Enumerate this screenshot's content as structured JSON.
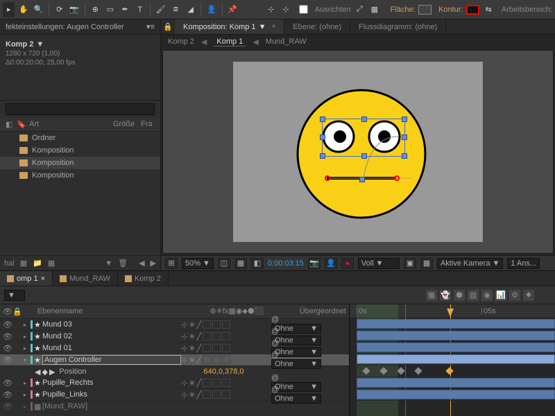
{
  "toolbar": {
    "align_label": "Ausrichten",
    "fill_label": "Fläche:",
    "stroke_label": "Kontur:",
    "workspace_label": "Arbeitsbereich:"
  },
  "effects_panel": {
    "tab_label": "fekteinstellungen: Augen Controller",
    "comp_name": "Komp 2",
    "resolution": "1280 x 720 (1,00)",
    "duration": "Δ0:00:20:00, 25,00 fps"
  },
  "project": {
    "cols": {
      "label": "",
      "art": "Art",
      "size": "Größe",
      "fr": "Fra"
    },
    "items": [
      {
        "name": "Ordner",
        "selected": false
      },
      {
        "name": "Komposition",
        "selected": false
      },
      {
        "name": "Komposition",
        "selected": true
      },
      {
        "name": "Komposition",
        "selected": false
      }
    ],
    "footer_label": "hal"
  },
  "comp_panel": {
    "tabs": [
      {
        "label": "Komposition: Komp 1",
        "active": true
      },
      {
        "label": "Ebene: (ohne)",
        "active": false
      },
      {
        "label": "Flussdiagramm: (ohne)",
        "active": false
      }
    ],
    "breadcrumb": [
      {
        "label": "Komp 2",
        "active": false
      },
      {
        "label": "Komp 1",
        "active": true
      },
      {
        "label": "Mund_RAW",
        "active": false
      }
    ],
    "zoom": "50%",
    "timecode": "0:00:03:15",
    "quality": "Voll",
    "camera": "Aktive Kamera",
    "views": "1 Ans..."
  },
  "timeline": {
    "tabs": [
      {
        "label": "omp 1",
        "active": true
      },
      {
        "label": "Mund_RAW",
        "active": false
      },
      {
        "label": "Komp 2",
        "active": false
      }
    ],
    "columns": {
      "name": "Ebenenname",
      "parent": "Übergeordnet"
    },
    "parent_none": "Ohne",
    "ruler": {
      "t0": "0s",
      "t1": "05s"
    },
    "layers": [
      {
        "name": "Mund 03",
        "selected": false,
        "shape": true,
        "color": "teal"
      },
      {
        "name": "Mund 02",
        "selected": false,
        "shape": true,
        "color": "teal"
      },
      {
        "name": "Mund 01",
        "selected": false,
        "shape": true,
        "color": "teal"
      },
      {
        "name": "Augen Controller",
        "selected": true,
        "shape": true,
        "color": "teal",
        "boxed": true
      },
      {
        "name": "Pupille_Rechts",
        "selected": false,
        "shape": true,
        "color": "pink"
      },
      {
        "name": "Pupille_Links",
        "selected": false,
        "shape": true,
        "color": "pink"
      },
      {
        "name": "[Mund_RAW]",
        "selected": false,
        "shape": false,
        "color": "pink"
      }
    ],
    "position_prop": {
      "label": "Position",
      "value": "640,0,378,0"
    }
  }
}
